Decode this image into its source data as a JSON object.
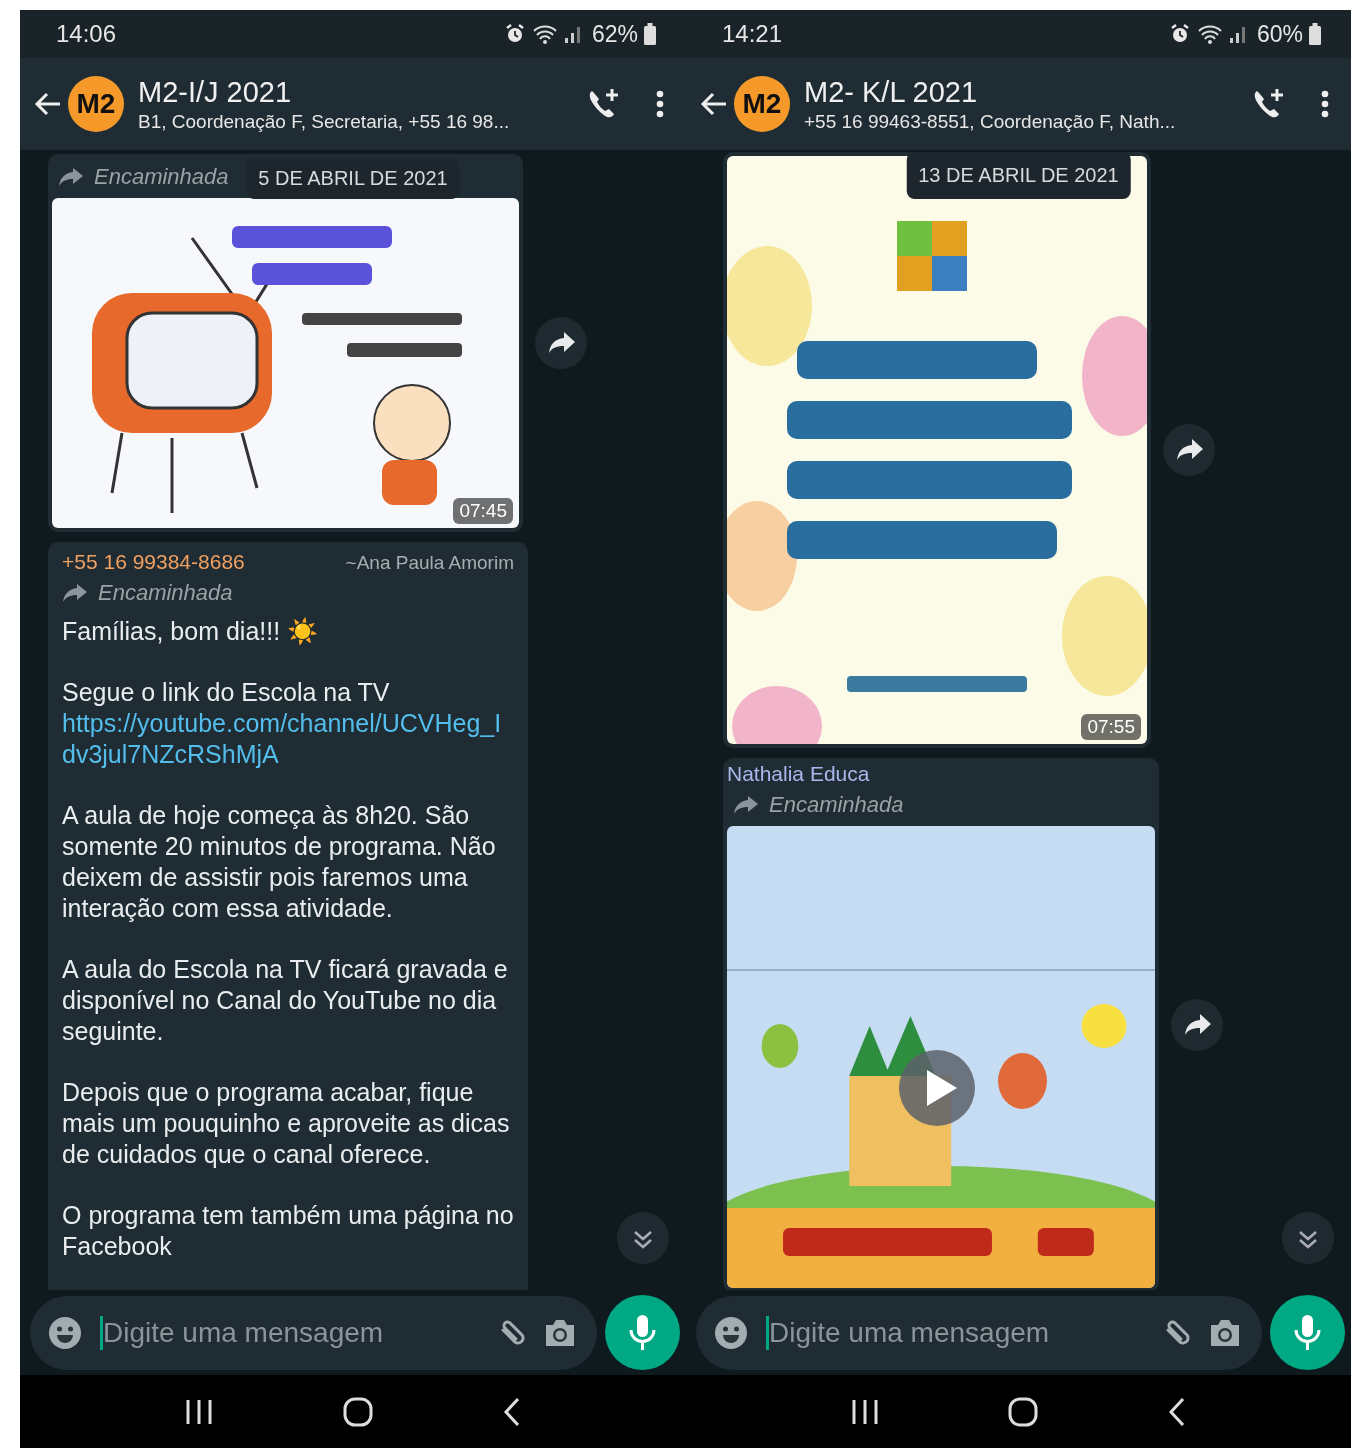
{
  "phones": [
    {
      "status_bar": {
        "time": "14:06",
        "battery": "62%"
      },
      "header": {
        "avatar": "M2",
        "title": "M2-I/J 2021",
        "subtitle": "B1, Coordenação F, Secretaria, +55 16 98..."
      },
      "date_chip": "5 DE ABRIL DE 2021",
      "messages": [
        {
          "kind": "flyer",
          "forwarded_label": "Encaminhada",
          "time": "07:45"
        },
        {
          "kind": "text",
          "sender": "+55 16 99384-8686",
          "color": "#f0a060",
          "sender_name": "~Ana  Paula Amorim",
          "forwarded_label": "Encaminhada",
          "paragraphs": [
            {
              "text": "Famílias, bom dia!!! ☀️"
            },
            {
              "text": "Segue o link do Escola na TV",
              "link": "https://youtube.com/channel/UCVHeg_Idv3jul7NZcRShMjA"
            },
            {
              "text": "A aula de hoje começa às 8h20. São somente 20 minutos de programa. Não deixem de assistir pois faremos uma interação com essa atividade."
            },
            {
              "text": "A aula do Escola na TV ficará gravada e disponível no Canal do YouTube no dia seguinte."
            },
            {
              "text": "Depois que o programa acabar, fique mais um pouquinho e aproveite as dicas de cuidados que o canal oferece."
            },
            {
              "text": "O programa tem também uma página no Facebook"
            }
          ]
        }
      ],
      "composer": {
        "placeholder": "Digite uma mensagem"
      }
    },
    {
      "status_bar": {
        "time": "14:21",
        "battery": "60%"
      },
      "header": {
        "avatar": "M2",
        "title": "M2- K/L 2021",
        "subtitle": "+55 16 99463-8551, Coordenação F, Nath..."
      },
      "date_chip": "13 DE ABRIL DE 2021",
      "messages": [
        {
          "kind": "poster",
          "time": "07:55"
        },
        {
          "kind": "video",
          "sender": "Nathalia Educa",
          "color": "#a8b8ec",
          "forwarded_label": "Encaminhada"
        }
      ],
      "composer": {
        "placeholder": "Digite uma mensagem"
      }
    }
  ]
}
